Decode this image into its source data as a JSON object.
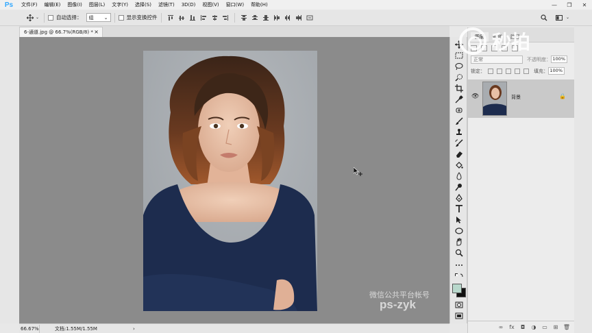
{
  "app": {
    "logo": "Ps"
  },
  "menu": [
    "文件(F)",
    "编辑(E)",
    "图像(I)",
    "图层(L)",
    "文字(Y)",
    "选择(S)",
    "滤镜(T)",
    "3D(D)",
    "视图(V)",
    "窗口(W)",
    "帮助(H)"
  ],
  "window_controls": {
    "minimize": "—",
    "restore": "❐",
    "close": "✕"
  },
  "options": {
    "auto_select_label": "自动选择：",
    "auto_select_value": "组",
    "show_transform_label": "显示变换控件"
  },
  "document": {
    "tab_title": "6-通道.jpg @ 66.7%(RGB/8) *",
    "tab_close": "×"
  },
  "status": {
    "zoom": "66.67%",
    "doc_info": "文档:1.55M/1.55M",
    "arrow": "›"
  },
  "canvas_watermark": {
    "line1": "微信公共平台帐号",
    "line2": "ps-zyk"
  },
  "overlay": {
    "brand_text": "秒拍"
  },
  "layers_panel": {
    "tabs": [
      "图层",
      "通道",
      "路径"
    ],
    "blend_mode": "正常",
    "opacity_label": "不透明度：",
    "opacity_value": "100%",
    "lock_label": "锁定：",
    "fill_label": "填充：",
    "fill_value": "100%",
    "layer_name": "背景",
    "bottom_icons": [
      "link-icon",
      "fx-icon",
      "mask-icon",
      "adjustment-icon",
      "group-icon",
      "new-layer-icon",
      "trash-icon"
    ]
  },
  "colors": {
    "canvas_bg": "#8b8b8b",
    "panel_bg": "#ececec",
    "selected_layer": "#c9c9c9",
    "foreground": "#b8d8cc",
    "background": "#111111"
  }
}
